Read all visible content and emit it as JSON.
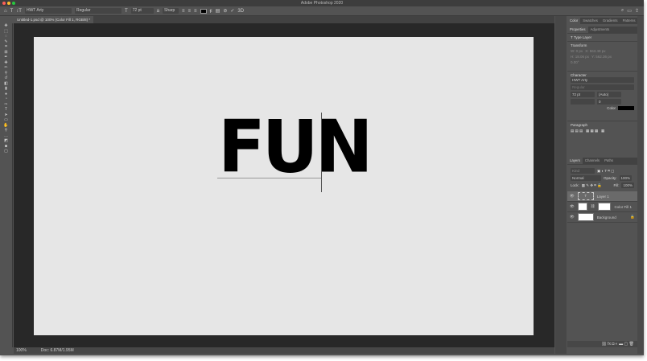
{
  "app": {
    "title": "Adobe Photoshop 2020"
  },
  "options": {
    "font_family": "HWT Arty",
    "font_style": "Regular",
    "font_size": "72 pt",
    "antialias": "Sharp",
    "text_color": "#000000"
  },
  "document": {
    "tab": "Untitled-1.psd @ 100% (Color Fill 1, RGB/8) *",
    "text": "FUN",
    "bg": "#e6e6e6"
  },
  "status": {
    "zoom": "100%",
    "doc": "Doc: 6.87M/1.95M"
  },
  "color_panel": {
    "tabs": [
      "Color",
      "Swatches",
      "Gradients",
      "Patterns"
    ]
  },
  "properties": {
    "tabs": [
      "Properties",
      "Adjustments"
    ],
    "type_label": "Type Layer",
    "transform": {
      "title": "Transform",
      "w": "W: 0 px",
      "x": "X: 563.48 px",
      "h": "H: 18.06 px",
      "y": "Y: 562.36 px",
      "angle": "0.00°"
    },
    "character": {
      "title": "Character",
      "font": "HWT Arty",
      "style": "Regular",
      "size": "72 pt",
      "leading": "(Auto)",
      "tracking": "0",
      "color_label": "Color"
    },
    "paragraph": {
      "title": "Paragraph"
    }
  },
  "layers": {
    "tabs": [
      "Layers",
      "Channels",
      "Paths"
    ],
    "kind": "Kind",
    "blend": "Normal",
    "opacity_label": "Opacity:",
    "opacity": "100%",
    "lock_label": "Lock:",
    "fill_label": "Fill:",
    "fill": "100%",
    "items": [
      {
        "name": "Layer 1"
      },
      {
        "name": "Color Fill 1"
      },
      {
        "name": "Background"
      }
    ]
  }
}
